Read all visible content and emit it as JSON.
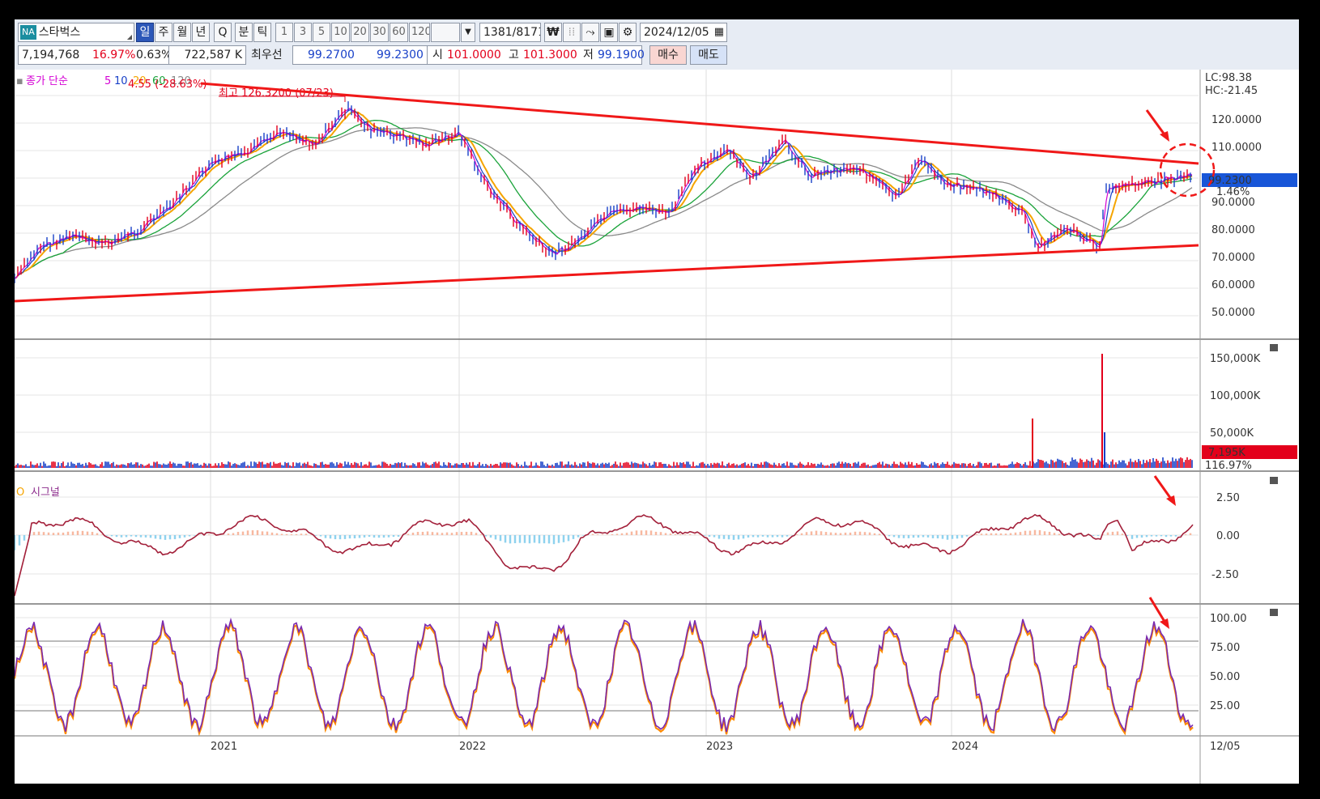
{
  "toolbar": {
    "symbol_badge": "NA",
    "symbol_name": "스타벅스",
    "period_tabs": [
      "일",
      "주",
      "월",
      "년",
      "Q",
      "분",
      "틱"
    ],
    "selected_period": "일",
    "minute_options": [
      "1",
      "3",
      "5",
      "10",
      "20",
      "30",
      "60",
      "120"
    ],
    "data_count": "1381",
    "data_total": "/8171",
    "date": "2024/12/05",
    "volume": "7,194,768",
    "change_pct": "16.97%",
    "ratio_pct": "0.63%",
    "amount": "722,587 K",
    "best_quote_label": "최우선",
    "ask_price": "99.2700",
    "bid_price": "99.2300",
    "open_label": "시",
    "open_value": "101.0000",
    "high_label": "고",
    "high_value": "101.3000",
    "low_label": "저",
    "low_value": "99.1900",
    "buy_button": "매수",
    "sell_button": "매도",
    "currency_icon": "won-icon",
    "colors": {
      "selected": "#2c57b8",
      "buy_bg": "#f9d6d2",
      "sell_bg": "#d6e2f7"
    }
  },
  "price_panel": {
    "legend": [
      "종가 단순",
      "5",
      "10",
      "20",
      "60",
      "120"
    ],
    "legend_colors": [
      "#d400d4",
      "#d400d4",
      "#1840c8",
      "#f5a400",
      "#1aa33a",
      "#888888"
    ],
    "annotation_low": "4.55 (-28.63%)",
    "annotation_high": "최고 126.3200 (07/23)",
    "lc": "LC:98.38",
    "hc": "HC:-21.45",
    "current_price": "99.2300",
    "current_change": "1.46%",
    "y_ticks": [
      "120.0000",
      "110.0000",
      "90.0000",
      "80.0000",
      "70.0000",
      "60.0000",
      "50.0000"
    ]
  },
  "volume_panel": {
    "y_ticks": [
      "150,000K",
      "100,000K",
      "50,000K"
    ],
    "current_volume": "7,195K",
    "current_pct": "116.97%"
  },
  "signal_panel": {
    "legend": "시그널",
    "y_ticks": [
      "2.50",
      "0.00",
      "-2.50"
    ]
  },
  "stoch_panel": {
    "y_ticks": [
      "100.00",
      "75.00",
      "50.00",
      "25.00"
    ]
  },
  "x_axis": {
    "labels": [
      "2021",
      "2022",
      "2023",
      "2024",
      "12/05"
    ]
  }
}
